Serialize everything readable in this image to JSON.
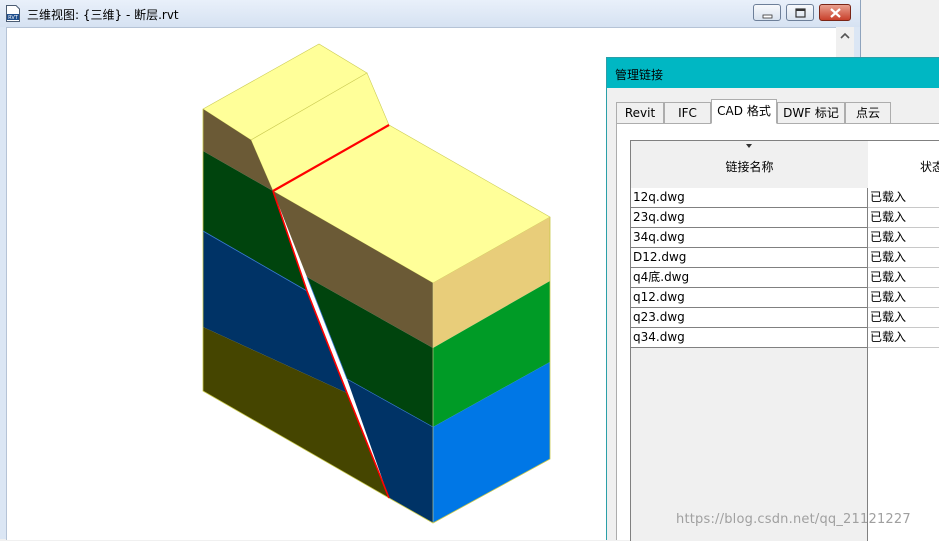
{
  "window": {
    "title": "三维视图: {三维} - 断层.rvt",
    "app_icon": "revit-file-icon",
    "controls": [
      "minimize-icon",
      "maximize-icon",
      "close-icon"
    ]
  },
  "model": {
    "description_colors": {
      "top_yellow": "#ffff99",
      "brown": "#6b5a36",
      "dark_green": "#00440d",
      "green": "#009b26",
      "navy": "#003366",
      "blue": "#0077e6",
      "olive": "#454500",
      "fault_line": "#ff0000"
    }
  },
  "dialog": {
    "title": "管理链接",
    "tabs": [
      {
        "label": "Revit",
        "active": false
      },
      {
        "label": "IFC",
        "active": false
      },
      {
        "label": "CAD 格式",
        "active": true
      },
      {
        "label": "DWF 标记",
        "active": false
      },
      {
        "label": "点云",
        "active": false
      }
    ],
    "columns": {
      "name": "链接名称",
      "status": "状态"
    },
    "rows": [
      {
        "name": "12q.dwg",
        "status": "已载入"
      },
      {
        "name": "23q.dwg",
        "status": "已载入"
      },
      {
        "name": "34q.dwg",
        "status": "已载入"
      },
      {
        "name": "D12.dwg",
        "status": "已载入"
      },
      {
        "name": "q4底.dwg",
        "status": "已载入"
      },
      {
        "name": "q12.dwg",
        "status": "已载入"
      },
      {
        "name": "q23.dwg",
        "status": "已载入"
      },
      {
        "name": "q34.dwg",
        "status": "已载入"
      }
    ]
  },
  "watermark": "https://blog.csdn.net/qq_21121227"
}
